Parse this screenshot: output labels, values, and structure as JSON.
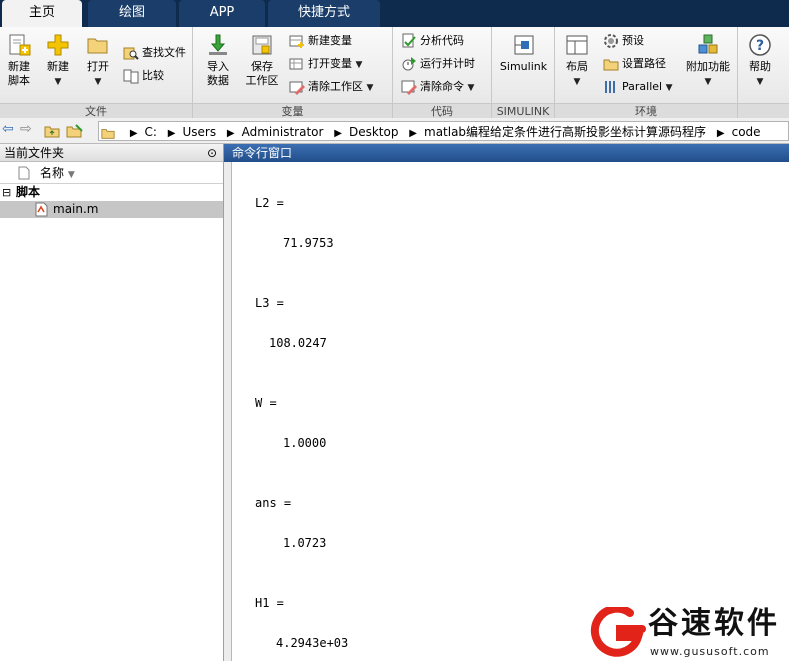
{
  "tabs": [
    "主页",
    "绘图",
    "APP",
    "快捷方式"
  ],
  "ribbon": {
    "file_group": {
      "title": "文件",
      "new_script": "新建\n脚本",
      "new": "新建",
      "open": "打开",
      "find_files": "查找文件",
      "compare": "比较"
    },
    "variable_group": {
      "title": "变量",
      "import_data": "导入\n数据",
      "save_workspace": "保存\n工作区",
      "new_variable": "新建变量",
      "open_variable": "打开变量",
      "clear_workspace": "清除工作区"
    },
    "code_group": {
      "title": "代码",
      "analyze_code": "分析代码",
      "run_and_time": "运行并计时",
      "clear_commands": "清除命令"
    },
    "simulink_group": {
      "title": "SIMULINK",
      "simulink": "Simulink"
    },
    "environment_group": {
      "title": "环境",
      "layout": "布局",
      "preferences": "预设",
      "set_path": "设置路径",
      "parallel": "Parallel",
      "addons": "附加功能"
    },
    "help": "帮助"
  },
  "address": {
    "crumbs": [
      "C:",
      "Users",
      "Administrator",
      "Desktop",
      "matlab编程给定条件进行高斯投影坐标计算源码程序",
      "code"
    ]
  },
  "current_folder": {
    "title": "当前文件夹",
    "column_name": "名称",
    "folder": "脚本",
    "file": "main.m"
  },
  "command_window": {
    "title": "命令行窗口",
    "lines": [
      "L2 =",
      "71.9753",
      "L3 =",
      "108.0247",
      "W =",
      "1.0000",
      "ans =",
      "1.0723",
      "H1 =",
      "4.2943e+03"
    ]
  },
  "watermark": {
    "brand": "谷速软件",
    "url": "www.gususoft.com"
  },
  "colors": {
    "tabbar": "#0e2a4d",
    "command_title": "#224e8b",
    "logo_red": "#e2231a"
  }
}
